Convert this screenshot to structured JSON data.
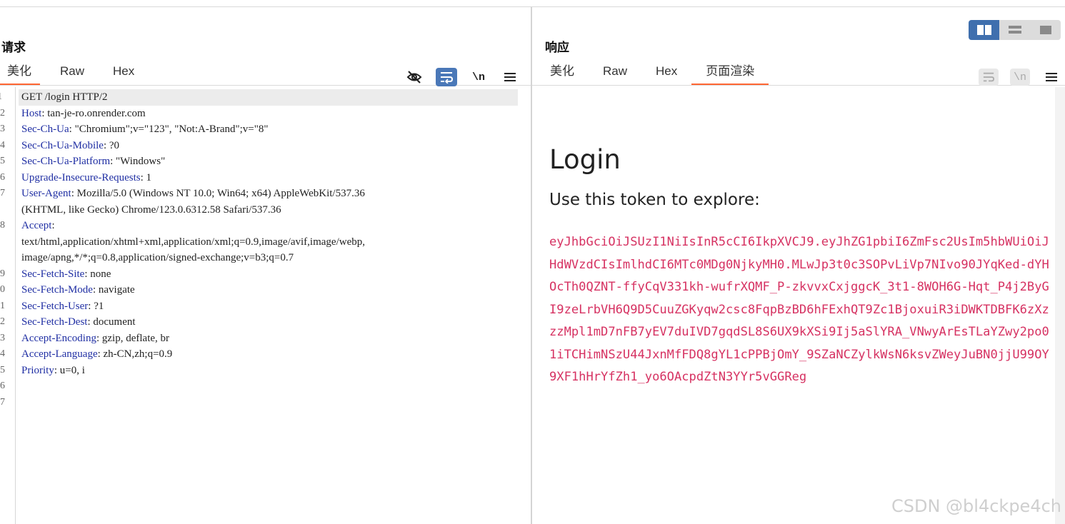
{
  "request": {
    "title": "请求",
    "tabs": [
      {
        "label": "美化",
        "active": true
      },
      {
        "label": "Raw",
        "active": false
      },
      {
        "label": "Hex",
        "active": false
      }
    ],
    "tools": {
      "hide_icon": "eye-slash-icon",
      "wrap_icon": "word-wrap-icon",
      "newline_label": "\\n",
      "menu_icon": "hamburger-menu-icon"
    },
    "lines": [
      {
        "n": "1",
        "name": "",
        "rest": "GET /login HTTP/2"
      },
      {
        "n": "2",
        "name": "Host",
        "rest": ": tan-je-ro.onrender.com"
      },
      {
        "n": "3",
        "name": "Sec-Ch-Ua",
        "rest": ": \"Chromium\";v=\"123\", \"Not:A-Brand\";v=\"8\""
      },
      {
        "n": "4",
        "name": "Sec-Ch-Ua-Mobile",
        "rest": ": ?0"
      },
      {
        "n": "5",
        "name": "Sec-Ch-Ua-Platform",
        "rest": ": \"Windows\""
      },
      {
        "n": "6",
        "name": "Upgrade-Insecure-Requests",
        "rest": ": 1"
      },
      {
        "n": "7",
        "name": "User-Agent",
        "rest": ": Mozilla/5.0 (Windows NT 10.0; Win64; x64) AppleWebKit/537.36"
      },
      {
        "n": "",
        "name": "",
        "rest": "(KHTML, like Gecko) Chrome/123.0.6312.58 Safari/537.36"
      },
      {
        "n": "8",
        "name": "Accept",
        "rest": ":"
      },
      {
        "n": "",
        "name": "",
        "rest": "text/html,application/xhtml+xml,application/xml;q=0.9,image/avif,image/webp,"
      },
      {
        "n": "",
        "name": "",
        "rest": "image/apng,*/*;q=0.8,application/signed-exchange;v=b3;q=0.7"
      },
      {
        "n": "9",
        "name": "Sec-Fetch-Site",
        "rest": ": none"
      },
      {
        "n": "0",
        "name": "Sec-Fetch-Mode",
        "rest": ": navigate"
      },
      {
        "n": "1",
        "name": "Sec-Fetch-User",
        "rest": ": ?1"
      },
      {
        "n": "2",
        "name": "Sec-Fetch-Dest",
        "rest": ": document"
      },
      {
        "n": "3",
        "name": "Accept-Encoding",
        "rest": ": gzip, deflate, br"
      },
      {
        "n": "4",
        "name": "Accept-Language",
        "rest": ": zh-CN,zh;q=0.9"
      },
      {
        "n": "5",
        "name": "Priority",
        "rest": ": u=0, i"
      },
      {
        "n": "6",
        "name": "",
        "rest": ""
      },
      {
        "n": "7",
        "name": "",
        "rest": ""
      }
    ]
  },
  "response": {
    "title": "响应",
    "tabs": [
      {
        "label": "美化",
        "active": false
      },
      {
        "label": "Raw",
        "active": false
      },
      {
        "label": "Hex",
        "active": false
      },
      {
        "label": "页面渲染",
        "active": true
      }
    ],
    "tools": {
      "wrap_icon": "word-wrap-icon",
      "newline_label": "\\n",
      "menu_icon": "hamburger-menu-icon"
    },
    "render": {
      "heading": "Login",
      "subheading": "Use this token to explore:",
      "token": "eyJhbGciOiJSUzI1NiIsInR5cCI6IkpXVCJ9.eyJhZG1pbiI6ZmFsc2UsIm5hbWUiOiJHdWVzdCIsImlhdCI6MTc0MDg0NjkyMH0.MLwJp3t0c3SOPvLiVp7NIvo90JYqKed-dYHOcTh0QZNT-ffyCqV331kh-wufrXQMF_P-zkvvxCxjggcK_3t1-8WOH6G-Hqt_P4j2ByGI9zeLrbVH6Q9D5CuuZGKyqw2csc8FqpBzBD6hFExhQT9Zc1BjoxuiR3iDWKTDBFK6zXzzzMpl1mD7nFB7yEV7duIVD7gqdSL8S6UX9kXSi9Ij5aSlYRA_VNwyArEsTLaYZwy2po01iTCHimNSzU44JxnMfFDQ8gYL1cPPBjOmY_9SZaNCZylkWsN6ksvZWeyJuBN0jjU99OY9XF1hHrYfZh1_yo6OAcpdZtN3YYr5vGGReg"
    }
  },
  "layout_switch": [
    "side-by-side-icon",
    "stacked-icon",
    "single-pane-icon"
  ],
  "watermark": "CSDN @bl4ckpe4ch",
  "colors": {
    "accent": "#ff6633",
    "header_name": "#1f2ea3",
    "token": "#d63262",
    "button_blue": "#4a78b8"
  }
}
